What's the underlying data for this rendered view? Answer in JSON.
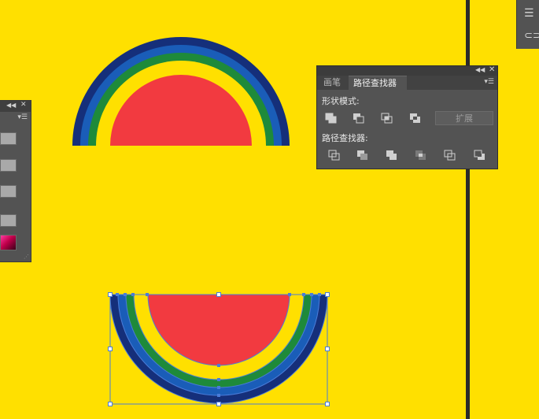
{
  "pathfinder_panel": {
    "tabs": [
      {
        "label": "画笔",
        "active": false
      },
      {
        "label": "路径查找器",
        "active": true
      }
    ],
    "shape_modes": {
      "title": "形状模式:",
      "buttons": [
        "unite-icon",
        "minus-front-icon",
        "intersect-icon",
        "exclude-icon"
      ],
      "expand_label": "扩展"
    },
    "pathfinders": {
      "title": "路径查找器:",
      "buttons": [
        "divide-icon",
        "trim-icon",
        "merge-icon",
        "crop-icon",
        "outline-icon",
        "minus-back-icon"
      ]
    },
    "collapse_icon": "double-chevron-left-icon",
    "close_icon": "close-icon",
    "menu_icon": "panel-menu-icon"
  },
  "left_panel": {
    "collapse_icon": "double-chevron-left-icon",
    "close_icon": "close-icon",
    "menu_icon": "panel-menu-icon"
  },
  "right_dock": {
    "icons": [
      "hamburger-icon",
      "link-icon"
    ]
  },
  "colors": {
    "canvas_background": "#FFE000",
    "navy_ring": "#152F7A",
    "blue_ring": "#1A5DB8",
    "green_ring": "#1E8A3A",
    "yellow_ring": "#FFE000",
    "red_fill": "#F23A40",
    "panel_background": "#535353",
    "selection_color": "#4A7CD9"
  }
}
